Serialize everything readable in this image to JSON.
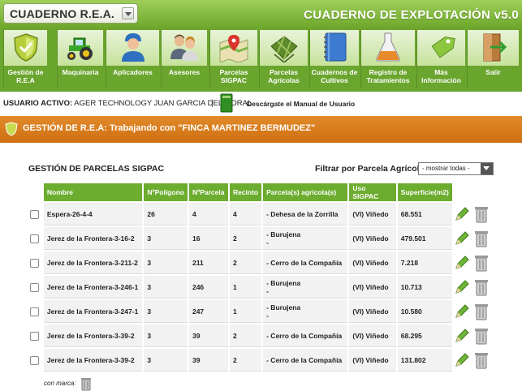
{
  "header": {
    "selector_label": "CUADERNO R.E.A.",
    "app_title": "CUADERNO DE EXPLOTACIÓN v5.0"
  },
  "nav": {
    "items": [
      {
        "label": "Gestión de R.E.A",
        "icon": "shield-icon"
      },
      {
        "label": "Maquinaria",
        "icon": "tractor-icon"
      },
      {
        "label": "Aplicadores",
        "icon": "worker-icon"
      },
      {
        "label": "Asesores",
        "icon": "advisors-icon"
      },
      {
        "label": "Parcelas SIGPAC",
        "icon": "map-pin-icon"
      },
      {
        "label": "Parcelas Agrícolas",
        "icon": "field-map-icon"
      },
      {
        "label": "Cuadernos de Cultivos",
        "icon": "notebook-icon"
      },
      {
        "label": "Registro de Tratamientos",
        "icon": "flask-icon"
      },
      {
        "label": "Más Información",
        "icon": "tag-icon"
      },
      {
        "label": "Salir",
        "icon": "exit-door-icon"
      }
    ]
  },
  "user": {
    "prefix": "USUARIO ACTIVO:",
    "name": "AGER TECHNOLOGY JUAN GARCIA DEL MORAL",
    "separator": "|",
    "manual_link": "Descárgate el Manual de Usuario"
  },
  "banner": {
    "text": "GESTIÓN DE R.E.A: Trabajando con \"FINCA MARTINEZ BERMUDEZ\""
  },
  "section": {
    "title": "GESTIÓN DE PARCELAS SIGPAC",
    "filter_label": "Filtrar por Parcela Agrícola:",
    "filter_value": "- mostrar todas -"
  },
  "table": {
    "headers": [
      "Nombre",
      "NºPolígono",
      "NºParcela",
      "Recinto",
      "Parcela(s) agrícola(s)",
      "Uso SIGPAC",
      "Superficie(m2)"
    ],
    "rows": [
      {
        "nombre": "Espera-26-4-4",
        "poligono": "26",
        "parcela": "4",
        "recinto": "4",
        "agricola": [
          "- Dehesa de la Zorrilla"
        ],
        "uso": "(VI) Viñedo",
        "superficie": "68.551"
      },
      {
        "nombre": "Jerez de la Frontera-3-16-2",
        "poligono": "3",
        "parcela": "16",
        "recinto": "2",
        "agricola": [
          "- Burujena",
          "-"
        ],
        "uso": "(VI) Viñedo",
        "superficie": "479.501"
      },
      {
        "nombre": "Jerez de la Frontera-3-211-2",
        "poligono": "3",
        "parcela": "211",
        "recinto": "2",
        "agricola": [
          "- Cerro de la Compañía"
        ],
        "uso": "(VI) Viñedo",
        "superficie": "7.218"
      },
      {
        "nombre": "Jerez de la Frontera-3-246-1",
        "poligono": "3",
        "parcela": "246",
        "recinto": "1",
        "agricola": [
          "- Burujena",
          "-"
        ],
        "uso": "(VI) Viñedo",
        "superficie": "10.713"
      },
      {
        "nombre": "Jerez de la Frontera-3-247-1",
        "poligono": "3",
        "parcela": "247",
        "recinto": "1",
        "agricola": [
          "- Burujena",
          "-"
        ],
        "uso": "(VI) Viñedo",
        "superficie": "10.580"
      },
      {
        "nombre": "Jerez de la Frontera-3-39-2",
        "poligono": "3",
        "parcela": "39",
        "recinto": "2",
        "agricola": [
          "- Cerro de la Compañía"
        ],
        "uso": "(VI) Viñedo",
        "superficie": "68.295"
      },
      {
        "nombre": "Jerez de la Frontera-3-39-2",
        "poligono": "3",
        "parcela": "39",
        "recinto": "2",
        "agricola": [
          "- Cerro de la Compañía"
        ],
        "uso": "(VI) Viñedo",
        "superficie": "131.802"
      }
    ]
  },
  "footer": {
    "marked_label": "con marca:"
  },
  "colors": {
    "brand_green": "#6aa52e",
    "banner_orange": "#d9781b",
    "header_cell_green": "#6cac2e"
  }
}
